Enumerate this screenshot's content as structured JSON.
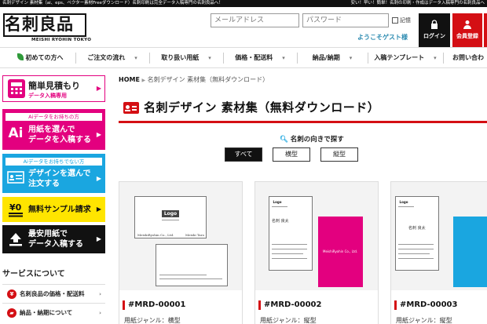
{
  "topbar": {
    "left": "名刺デザイン 素材集（ai、eps、ベクター素材Freeダウンロード）名刺印刷は完全データ入稿専門の名刺良品へ！",
    "right": "安い！早い！簡単！名刺の印刷・作成はデータ入稿専門の名刺良品へ"
  },
  "header": {
    "logo_jp": "名刺良品",
    "logo_en": "MEISHI RYOHIN TOKYO",
    "email_placeholder": "メールアドレス",
    "password_placeholder": "パスワード",
    "remember_label": "記憶",
    "welcome": "ようこそゲスト様",
    "login_label": "ログイン",
    "register_label": "会員登録"
  },
  "nav": {
    "items": [
      {
        "label": "初めての方へ"
      },
      {
        "label": "ご注文の流れ"
      },
      {
        "label": "取り扱い用紙"
      },
      {
        "label": "価格・配送料"
      },
      {
        "label": "納品/納期"
      },
      {
        "label": "入稿テンプレート"
      },
      {
        "label": "お問い合わ"
      }
    ]
  },
  "sidebar": {
    "quote_title": "簡単見積もり",
    "quote_sub": "データ入稿専用",
    "ai_have_caption": "Aiデータをお持ちの方",
    "ai_have_text1": "用紙を選んで",
    "ai_have_text2": "データを入稿する",
    "ai_none_caption": "Aiデータをお持ちでない方",
    "ai_none_text1": "デザインを選んで",
    "ai_none_text2": "注文する",
    "sample_text": "無料サンプル請求",
    "cheapest_text1": "最安用紙で",
    "cheapest_text2": "データ入稿する",
    "service_heading": "サービスについて",
    "links": [
      {
        "label": "名刺良品の価格・配送料"
      },
      {
        "label": "納品・納期について"
      }
    ]
  },
  "main": {
    "breadcrumb_home": "HOME",
    "breadcrumb_current": "名刺デザイン 素材集（無料ダウンロード）",
    "title": "名刺デザイン 素材集（無料ダウンロード）",
    "orientation_label": "名刺の向きで探す",
    "filters": [
      {
        "label": "すべて"
      },
      {
        "label": "横型"
      },
      {
        "label": "縦型"
      }
    ],
    "cards": [
      {
        "code": "#MRD-00001",
        "genre": "用紙ジャンル：横型"
      },
      {
        "code": "#MRD-00002",
        "genre": "用紙ジャンル：縦型"
      },
      {
        "code": "#MRD-00003",
        "genre": "用紙ジャンル：縦型"
      }
    ],
    "thumb_text": {
      "logo": "Logo",
      "company": "MeishiRyohin Co., Ltd.",
      "name_en": "Meishi Taro",
      "name_jp": "名刺 良太"
    }
  },
  "colors": {
    "brand_red": "#d40f14",
    "magenta": "#e3007f",
    "cyan": "#1aa6e0",
    "yellow": "#ffe500",
    "link_blue": "#2a8ab0"
  }
}
